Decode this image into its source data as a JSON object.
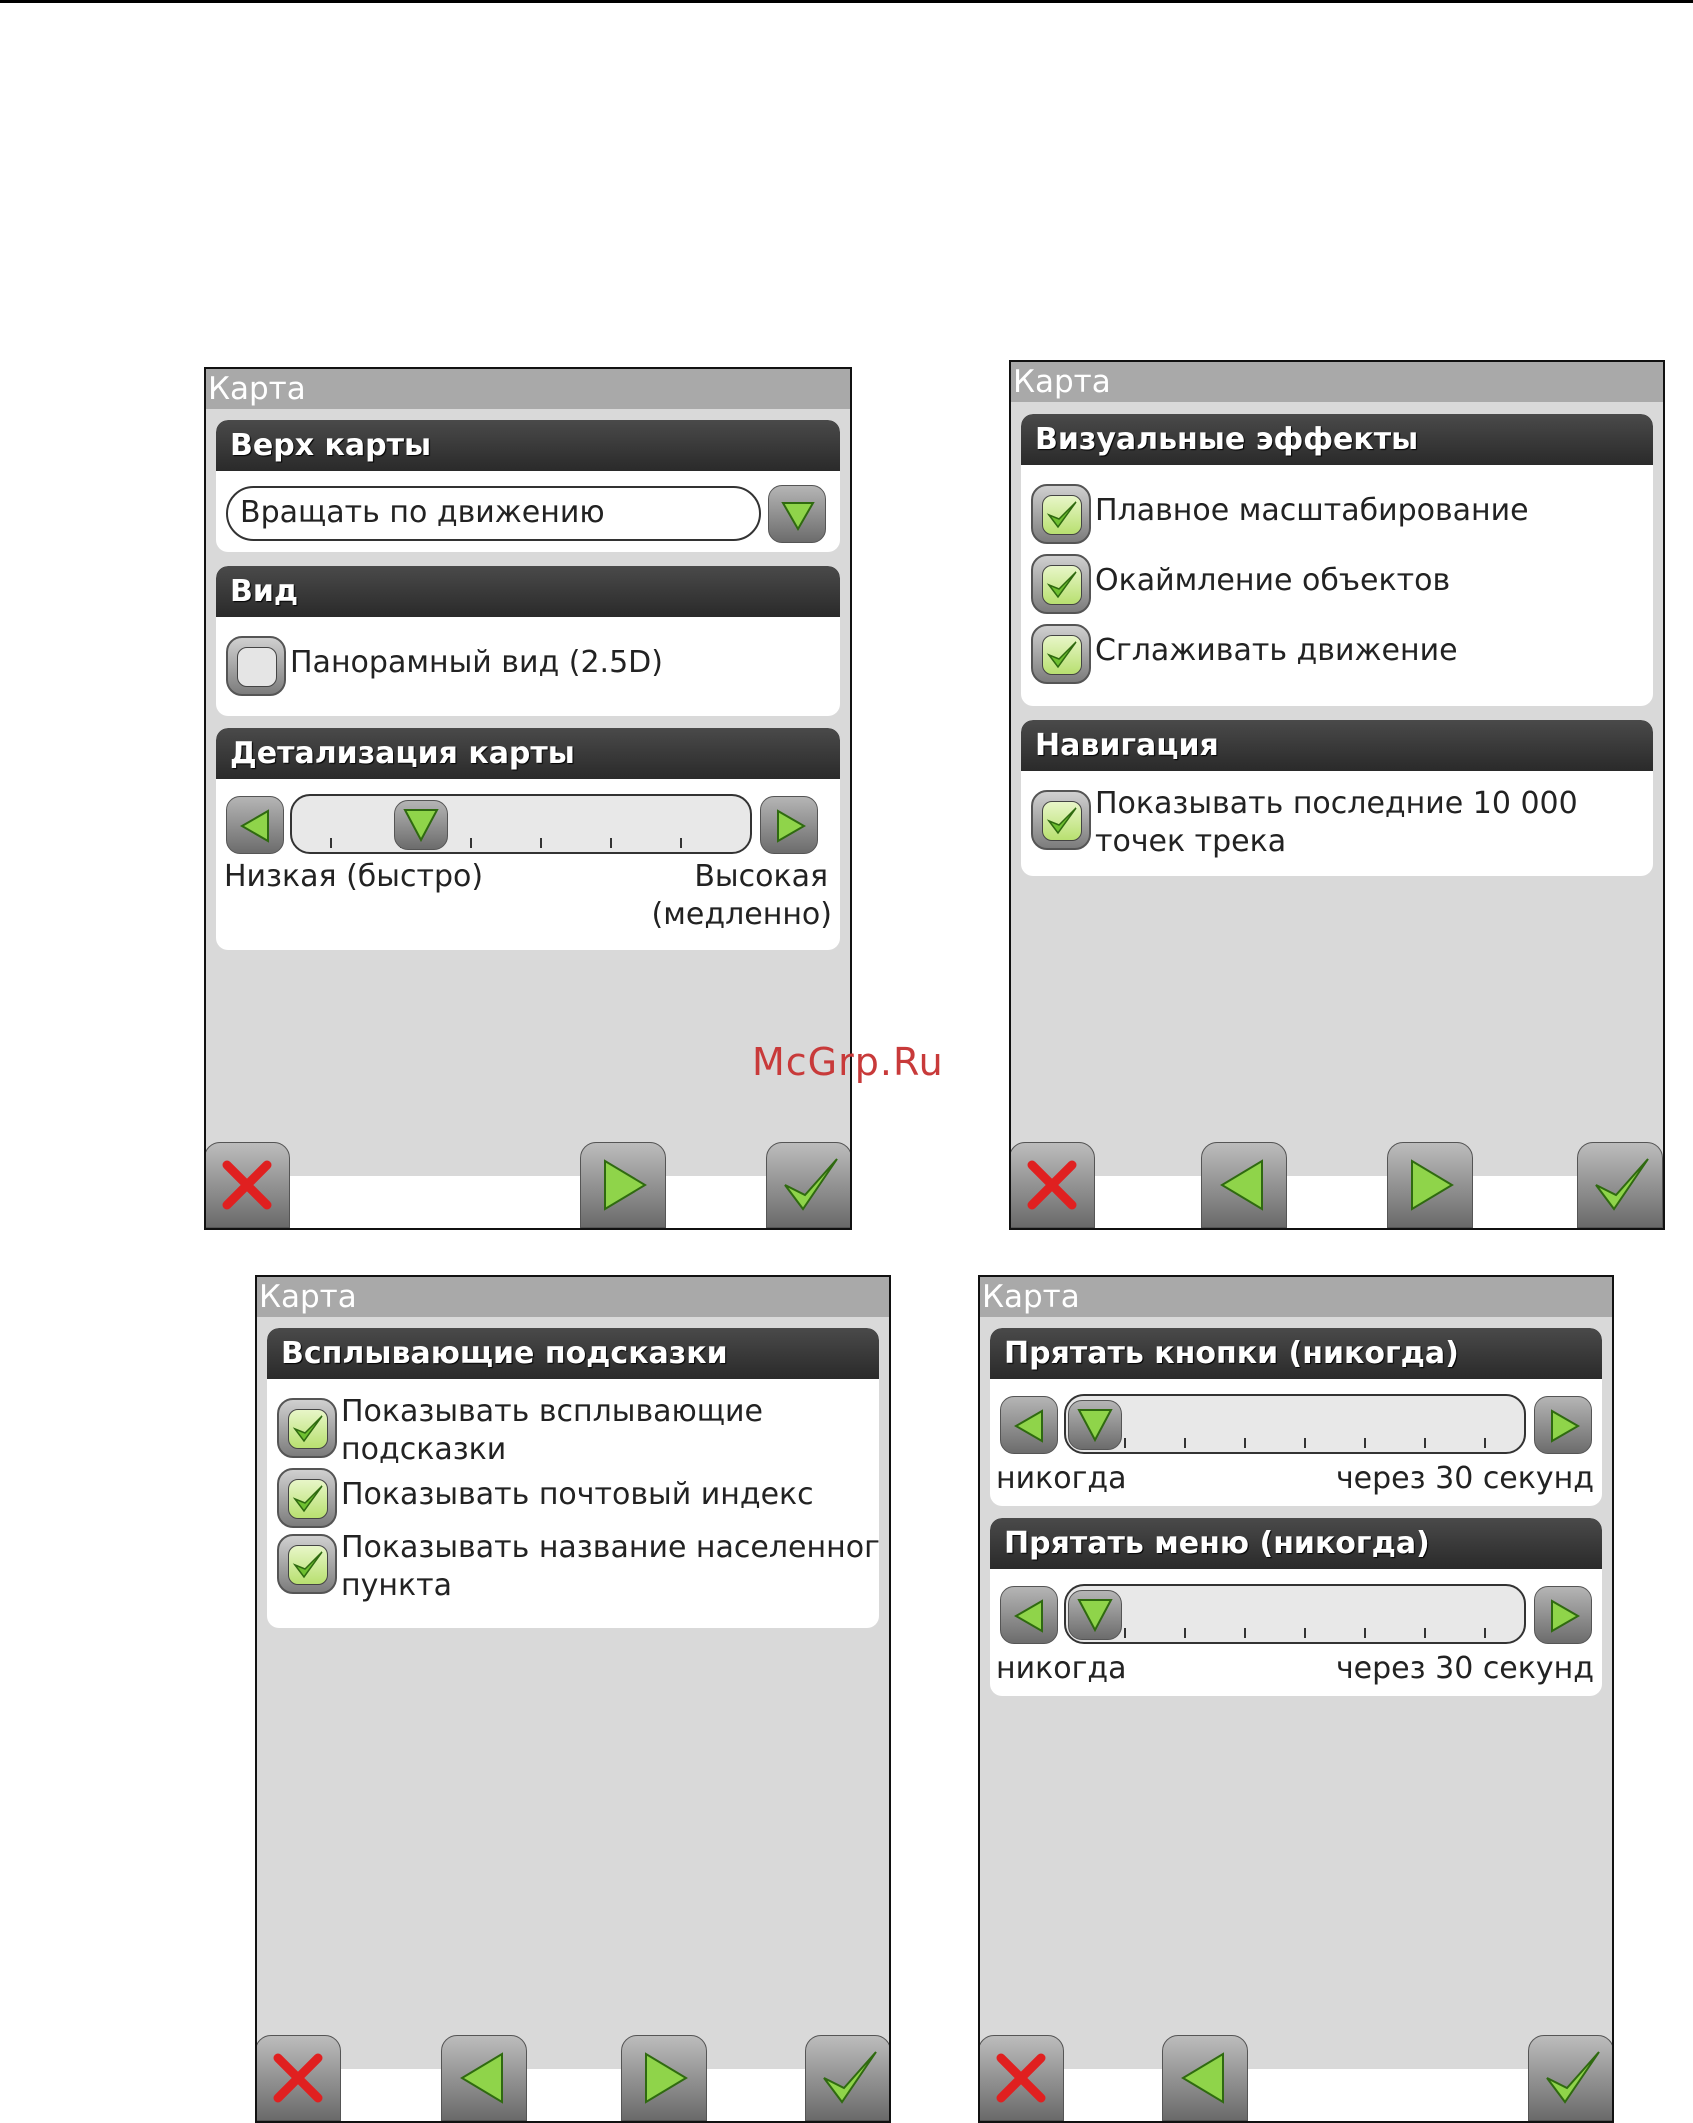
{
  "watermark": "McGrp.Ru",
  "screens": [
    {
      "title": "Карта",
      "map_top": {
        "header": "Верх карты",
        "dropdown_value": "Вращать по движению"
      },
      "view": {
        "header": "Вид",
        "panorama_label": "Панорамный вид (2.5D)",
        "panorama_checked": false
      },
      "detail": {
        "header": "Детализация карты",
        "level": 0.25,
        "low_label": "Низкая (быстро)",
        "high_label_1": "Высокая",
        "high_label_2": "(медленно)"
      },
      "buttons": [
        "close-icon",
        "arrow-right-icon",
        "checkmark-icon"
      ]
    },
    {
      "title": "Карта",
      "visual": {
        "header": "Визуальные эффекты",
        "smooth_zoom": "Плавное масштабирование",
        "outline": "Окаймление объектов",
        "smooth_move": "Сглаживать движение"
      },
      "navigation": {
        "header": "Навигация",
        "track_line1": "Показывать последние 10 000",
        "track_line2": "точек трека"
      },
      "buttons": [
        "close-icon",
        "arrow-left-icon",
        "arrow-right-icon",
        "checkmark-icon"
      ]
    },
    {
      "title": "Карта",
      "tips": {
        "header": "Всплывающие подсказки",
        "show_tips_1": "Показывать всплывающие",
        "show_tips_2": "подсказки",
        "show_zip": "Показывать почтовый индекс",
        "show_place_1": "Показывать название населенного",
        "show_place_2": "пункта"
      },
      "buttons": [
        "close-icon",
        "arrow-left-icon",
        "arrow-right-icon",
        "checkmark-icon"
      ]
    },
    {
      "title": "Карта",
      "hide_buttons": {
        "header": "Прятать кнопки (никогда)",
        "level": 0,
        "left_label": "никогда",
        "right_label": "через 30 секунд"
      },
      "hide_menu": {
        "header": "Прятать меню (никогда)",
        "level": 0,
        "left_label": "никогда",
        "right_label": "через 30 секунд"
      },
      "buttons": [
        "close-icon",
        "arrow-left-icon",
        "checkmark-icon"
      ]
    }
  ],
  "colors": {
    "accent_green": "#7ec43a",
    "close_red": "#e02020",
    "header_dark": "#333333",
    "title_gray": "#a9a9a9"
  }
}
